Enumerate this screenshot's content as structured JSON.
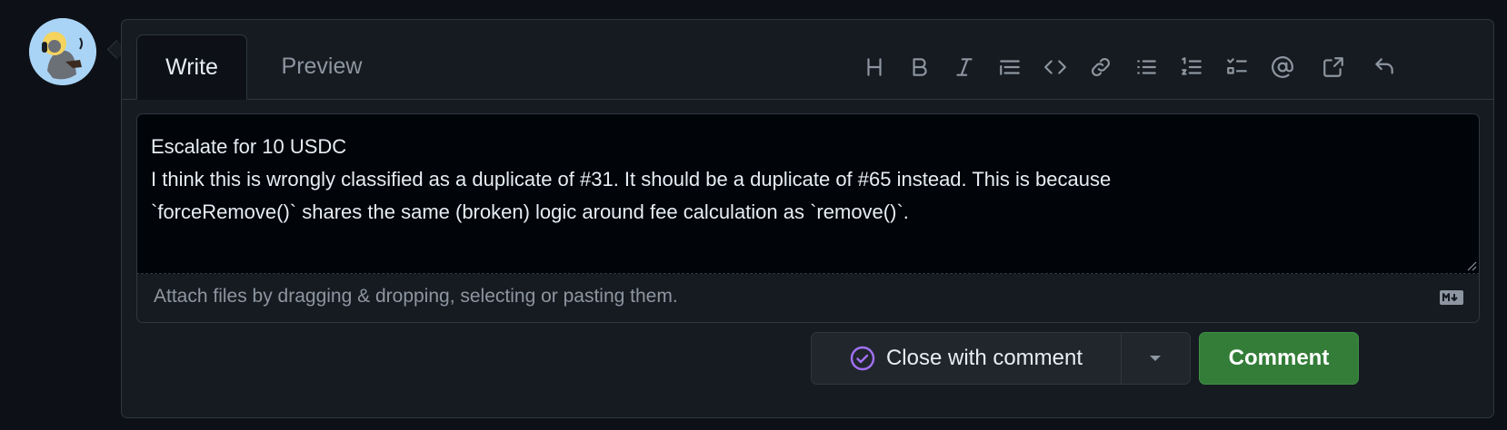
{
  "tabs": {
    "write": "Write",
    "preview": "Preview"
  },
  "toolbar": {
    "tools": [
      "heading-icon",
      "bold-icon",
      "italic-icon",
      "quote-icon",
      "code-icon",
      "link-icon",
      "bulleted-list-icon",
      "numbered-list-icon",
      "task-list-icon",
      "mention-icon",
      "cross-reference-icon",
      "reply-icon"
    ]
  },
  "editor": {
    "value": "Escalate for 10 USDC\nI think this is wrongly classified as a duplicate of #31. It should be a duplicate of #65 instead. This is because\n`forceRemove()` shares the same (broken) logic around fee calculation as `remove()`."
  },
  "attach": {
    "text": "Attach files by dragging & dropping, selecting or pasting them."
  },
  "actions": {
    "close_label": "Close with comment",
    "comment_label": "Comment"
  },
  "colors": {
    "accent_green": "#347d39",
    "close_icon": "#a371f7",
    "background": "#0d1117"
  }
}
